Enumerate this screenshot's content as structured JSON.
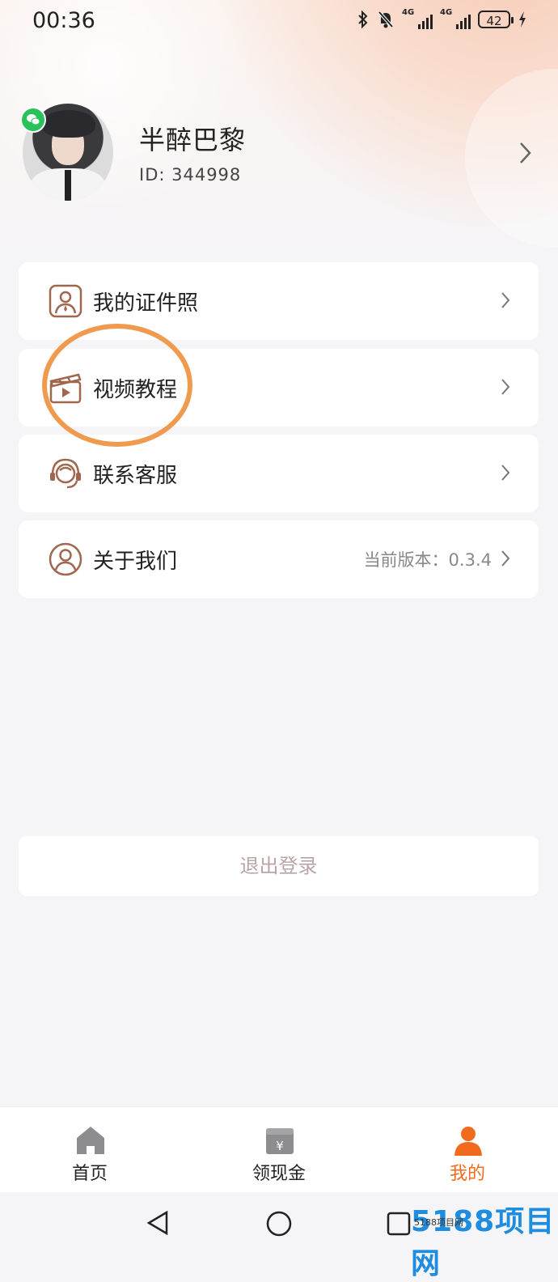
{
  "status_bar": {
    "time": "00:36",
    "battery": "42",
    "network1": "4G",
    "network2": "4G",
    "icons": [
      "bluetooth-icon",
      "mute-bell-icon",
      "signal-icon",
      "signal-icon",
      "battery-icon",
      "charging-icon"
    ]
  },
  "profile": {
    "nickname": "半醉巴黎",
    "id_text": "ID:  344998"
  },
  "menu": [
    {
      "label": "我的证件照",
      "icon": "id-photo-icon"
    },
    {
      "label": "视频教程",
      "icon": "video-clapper-icon"
    },
    {
      "label": "联系客服",
      "icon": "customer-service-icon"
    },
    {
      "label": "关于我们",
      "icon": "user-circle-icon",
      "extra": "当前版本：0.3.4"
    }
  ],
  "logout_label": "退出登录",
  "tabs": [
    {
      "label": "首页",
      "icon": "home-icon",
      "active": false
    },
    {
      "label": "领现金",
      "icon": "cash-icon",
      "active": false
    },
    {
      "label": "我的",
      "icon": "profile-icon",
      "active": true
    }
  ],
  "watermark": {
    "text": "5188项目网",
    "small": "5188项目网"
  },
  "colors": {
    "accent": "#f06b1d",
    "icon_brown": "#a0674f",
    "highlight_ring": "#ef9a4e",
    "wechat": "#29c15a"
  }
}
